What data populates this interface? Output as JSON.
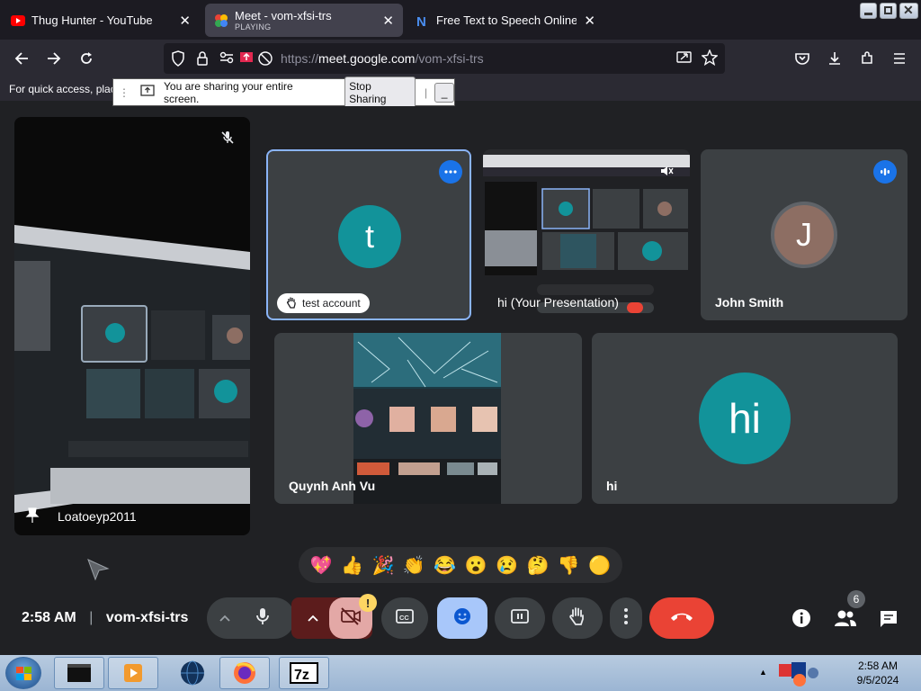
{
  "browser": {
    "tabs": [
      {
        "title": "Thug Hunter - YouTube",
        "icon": "youtube-icon"
      },
      {
        "title": "Meet - vom-xfsi-trs",
        "subtitle": "PLAYING",
        "icon": "meet-icon"
      },
      {
        "title": "Free Text to Speech Online with",
        "icon": "naturalreader-icon"
      }
    ],
    "url_prefix": "https://",
    "url_host": "meet.google.com",
    "url_path": "/vom-xfsi-trs",
    "bookmarks_hint": "For quick access, plac",
    "share_notice": {
      "message": "You are sharing your entire screen.",
      "stop_label": "Stop Sharing",
      "minimize_label": "_"
    }
  },
  "meet": {
    "tiles": [
      {
        "name": "Loatoeyp2011",
        "muted": true,
        "pinned": true
      },
      {
        "name": "test account",
        "initial": "t",
        "avatar_color": "#12939a",
        "hand_raised": true
      },
      {
        "name": "hi (Your Presentation)",
        "muted": true
      },
      {
        "name": "John Smith",
        "initial": "J",
        "avatar_color": "#8d6e63"
      },
      {
        "name": "Quynh Anh Vu"
      },
      {
        "name": "hi",
        "initial": "hi",
        "avatar_color": "#12939a"
      }
    ],
    "reactions": [
      "💖",
      "👍",
      "🎉",
      "👏",
      "😂",
      "😮",
      "😢",
      "🤔",
      "👎",
      "🟡"
    ],
    "time": "2:58 AM",
    "meeting_code": "vom-xfsi-trs",
    "participant_count": "6",
    "camera_warning": "!"
  },
  "taskbar": {
    "time": "2:58 AM",
    "date": "9/5/2024"
  },
  "colors": {
    "meet_bg": "#202124",
    "tile_bg": "#3c4043",
    "accent_blue": "#1a73e8",
    "active_tile_border": "#8ab4f8",
    "leave_red": "#ea4335",
    "reaction_active": "#a8c7fa"
  }
}
